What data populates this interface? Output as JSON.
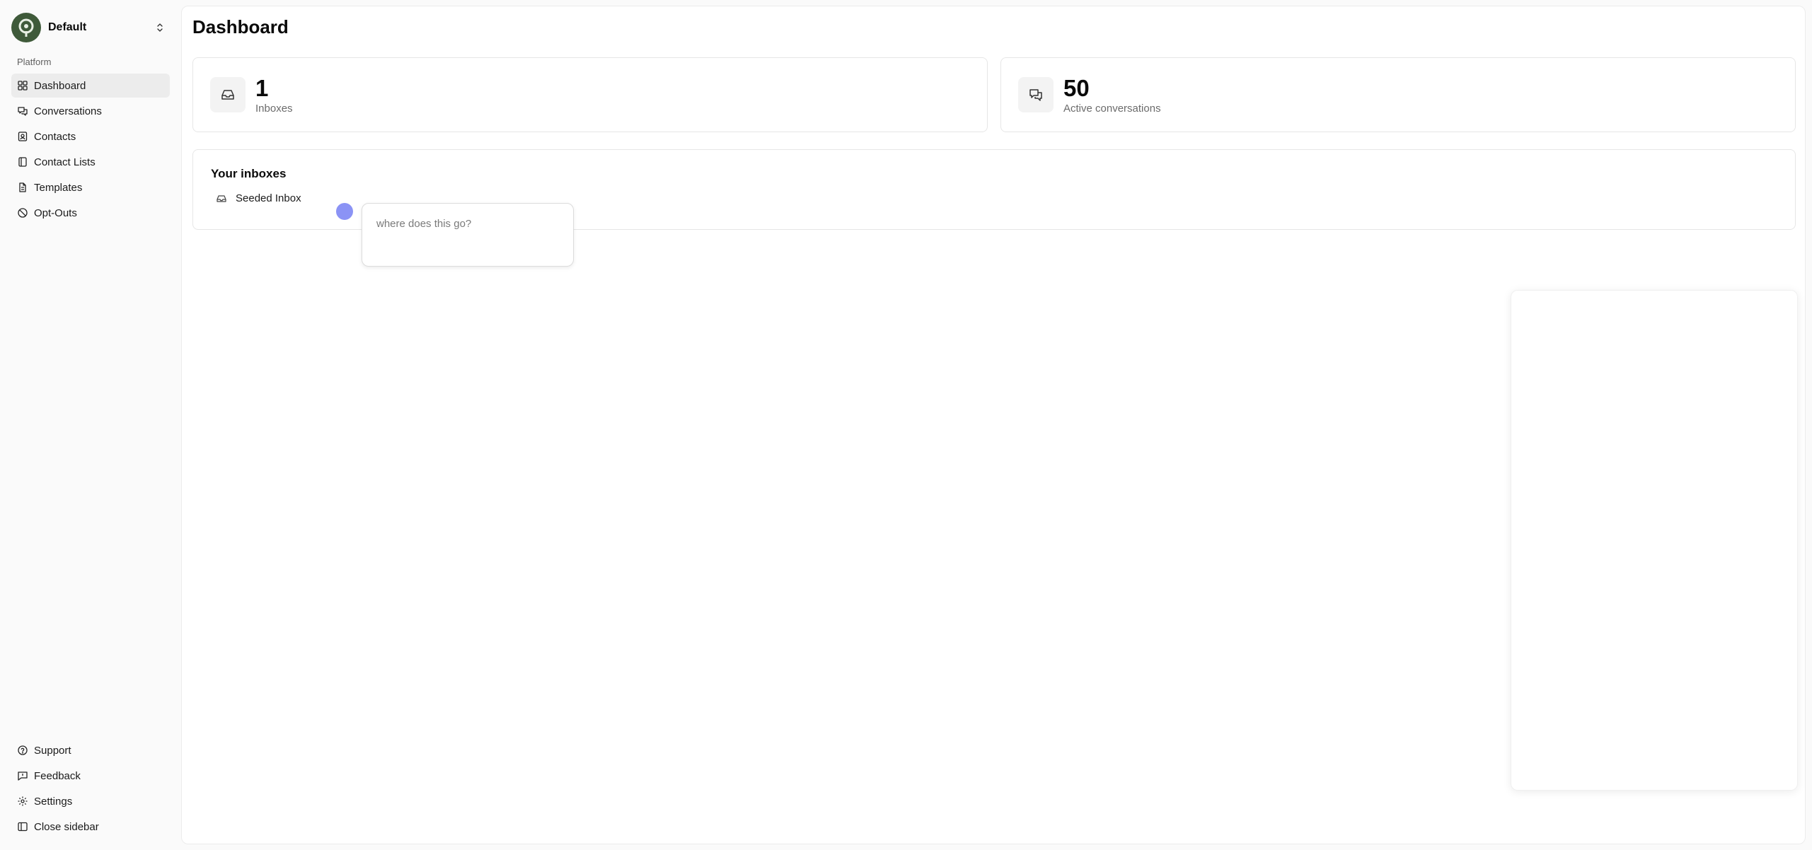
{
  "org": {
    "name": "Default"
  },
  "sidebar": {
    "section_label": "Platform",
    "items": [
      {
        "label": "Dashboard",
        "icon": "grid-icon"
      },
      {
        "label": "Conversations",
        "icon": "chat-bubbles-icon"
      },
      {
        "label": "Contacts",
        "icon": "contact-book-icon"
      },
      {
        "label": "Contact Lists",
        "icon": "notebook-icon"
      },
      {
        "label": "Templates",
        "icon": "file-text-icon"
      },
      {
        "label": "Opt-Outs",
        "icon": "ban-icon"
      }
    ],
    "bottom_items": [
      {
        "label": "Support",
        "icon": "help-circle-icon"
      },
      {
        "label": "Feedback",
        "icon": "message-square-icon"
      },
      {
        "label": "Settings",
        "icon": "gear-icon"
      },
      {
        "label": "Close sidebar",
        "icon": "panel-left-icon"
      }
    ]
  },
  "main": {
    "title": "Dashboard",
    "stats": [
      {
        "value": "1",
        "label": "Inboxes",
        "icon": "inbox-icon"
      },
      {
        "value": "50",
        "label": "Active conversations",
        "icon": "chat-bubbles-icon"
      }
    ],
    "inboxes": {
      "title": "Your inboxes",
      "items": [
        {
          "label": "Seeded Inbox",
          "icon": "inbox-icon"
        }
      ]
    }
  },
  "comment": {
    "placeholder": "where does this go?"
  },
  "colors": {
    "accent_dot": "#8b93f5",
    "logo": "#3f5a3a",
    "active_bg": "#ececec"
  }
}
